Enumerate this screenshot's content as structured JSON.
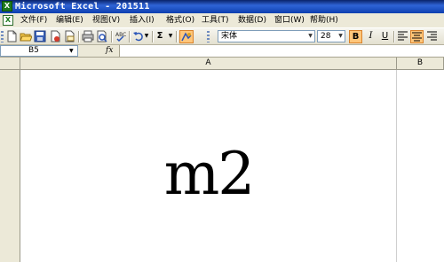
{
  "window": {
    "title": "Microsoft Excel - 201511",
    "app_icon_glyph": "X"
  },
  "menu": {
    "items": [
      "文件(F)",
      "编辑(E)",
      "视图(V)",
      "插入(I)",
      "格式(O)",
      "工具(T)",
      "数据(D)",
      "窗口(W)",
      "帮助(H)"
    ]
  },
  "toolbar": {
    "autosum_glyph": "Σ",
    "font_name": "宋体",
    "font_size": "28",
    "bold_label": "B",
    "italic_label": "I",
    "underline_label": "U"
  },
  "formula_bar": {
    "name_box": "B5",
    "fx_label": "fx",
    "formula": ""
  },
  "sheet": {
    "columns": [
      "A",
      "B"
    ],
    "cell_A1": "m2"
  },
  "colors": {
    "title_bar": "#0a246a",
    "chrome": "#ece9d8",
    "active_button": "#ffc67a"
  },
  "icons": {
    "new": "new-document-icon",
    "open": "open-folder-icon",
    "save": "save-icon",
    "permission": "permission-icon",
    "email": "email-icon",
    "print": "print-icon",
    "print_preview": "print-preview-icon",
    "spelling": "spelling-icon",
    "undo": "undo-icon",
    "autosum": "autosum-icon",
    "drawing": "drawing-icon"
  }
}
